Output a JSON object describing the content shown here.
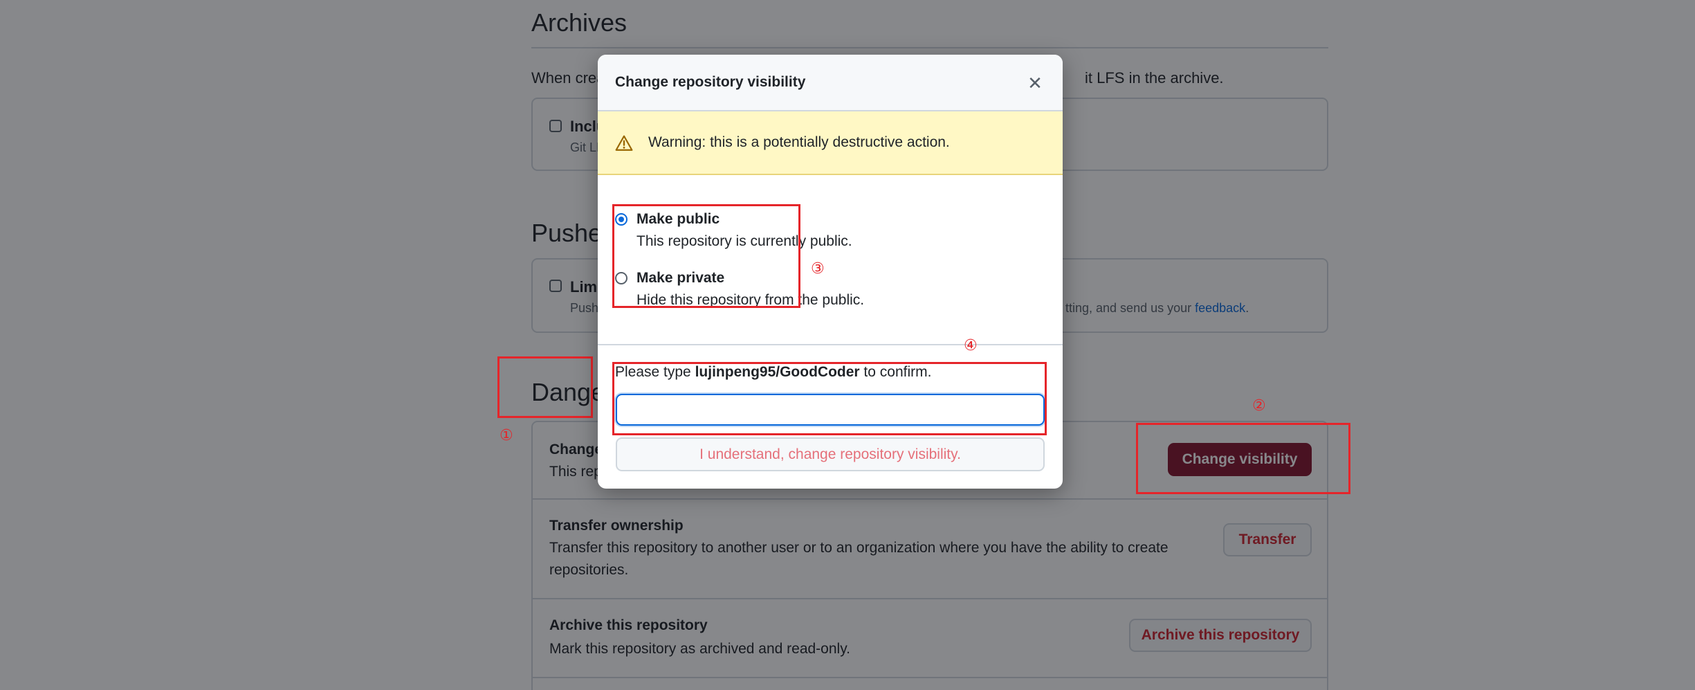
{
  "archives": {
    "heading": "Archives",
    "intro_start": "When crea",
    "intro_end": "it LFS in the archive.",
    "option_label": "Inclu",
    "option_sub": "Git LF"
  },
  "pushes": {
    "heading": "Pushe",
    "option_label": "Limi",
    "option_sub": "Pushe",
    "feedback_prefix": "tting, and send us your ",
    "feedback_link": "feedback",
    "feedback_suffix": "."
  },
  "danger_zone": {
    "heading": "Dange",
    "change_visibility": {
      "title": "Change",
      "desc": "This rep",
      "button": "Change visibility"
    },
    "transfer": {
      "title": "Transfer ownership",
      "desc": "Transfer this repository to another user or to an organization where you have the ability to create repositories.",
      "button": "Transfer"
    },
    "archive": {
      "title": "Archive this repository",
      "desc": "Mark this repository as archived and read-only.",
      "button": "Archive this repository"
    }
  },
  "modal": {
    "title": "Change repository visibility",
    "close_glyph": "✕",
    "warning": "Warning: this is a potentially destructive action.",
    "options": [
      {
        "label": "Make public",
        "sub": "This repository is currently public.",
        "checked": true
      },
      {
        "label": "Make private",
        "sub": "Hide this repository from the public.",
        "checked": false
      }
    ],
    "confirm_prefix": "Please type ",
    "confirm_repo": "lujinpeng95/GoodCoder",
    "confirm_suffix": " to confirm.",
    "confirm_input_value": "",
    "confirm_button": "I understand, change repository visibility."
  },
  "annotations": {
    "n1": "①",
    "n2": "②",
    "n3": "③",
    "n4": "④"
  },
  "colors": {
    "danger_button_bg": "#82132c",
    "annotation_red": "#e5252a",
    "warning_bg": "#fff8c5",
    "focus_blue": "#0969da"
  }
}
